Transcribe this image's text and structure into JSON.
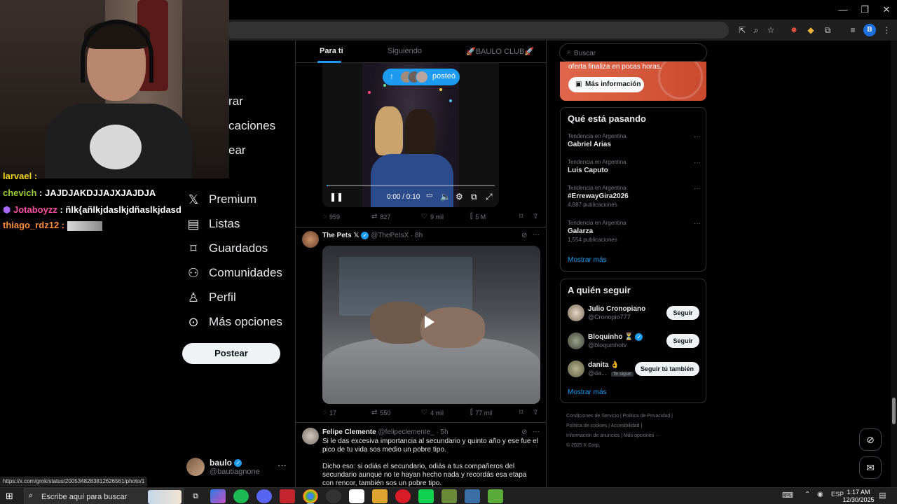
{
  "feed": {
    "tabs": [
      "Para ti",
      "Siguiendo",
      "🚀BAULO CLUB🚀"
    ],
    "posteo_label": "posteó",
    "video_time": "0:00 / 0:10"
  },
  "nav": {
    "partial_items": [
      "rar",
      "caciones",
      "ear"
    ],
    "items": [
      {
        "label": "Premium",
        "icon": "x-logo-icon"
      },
      {
        "label": "Listas",
        "icon": "list-icon"
      },
      {
        "label": "Guardados",
        "icon": "bookmark-icon"
      },
      {
        "label": "Comunidades",
        "icon": "people-icon"
      },
      {
        "label": "Perfil",
        "icon": "person-icon"
      },
      {
        "label": "Más opciones",
        "icon": "more-circle-icon"
      }
    ],
    "post_button": "Postear",
    "account": {
      "name": "baulo",
      "handle": "@bautiagnone",
      "more": "···"
    }
  },
  "tweets": [
    {
      "actions": {
        "replies": "959",
        "reposts": "827",
        "likes": "9 mil",
        "views": "5 M"
      }
    },
    {
      "name": "The Pets 𝕏",
      "handle": "@ThePetsX",
      "time": "· 8h",
      "actions": {
        "replies": "17",
        "reposts": "550",
        "likes": "4 mil",
        "views": "77 mil"
      }
    },
    {
      "name": "Felipe Clemente",
      "handle": "@felipeclemente_",
      "time": "· 5h",
      "text1": "Si le das excesiva importancia al secundario y quinto año y ese fue el pico de tu vida sos medio un pobre tipo.",
      "text2": "Dicho eso: si odiás el secundario, odiás a tus compañeros del secundario aunque no te hayan hecho nada y recordás esa etapa con rencor, también sos un pobre tipo."
    }
  ],
  "right": {
    "search_placeholder": "Buscar",
    "promo": {
      "text": "oferta finaliza en pocas horas.",
      "button": "Más información"
    },
    "trending": {
      "title": "Qué está pasando",
      "items": [
        {
          "context": "Tendencia en Argentina",
          "title": "Gabriel Arias",
          "count": ""
        },
        {
          "context": "Tendencia en Argentina",
          "title": "Luis Caputo",
          "count": ""
        },
        {
          "context": "Tendencia en Argentina",
          "title": "#ErrewayGira2026",
          "count": "4,887 publicaciones"
        },
        {
          "context": "Tendencia en Argentina",
          "title": "Galarza",
          "count": "1,554 publicaciones"
        }
      ],
      "show_more": "Mostrar más"
    },
    "who_to_follow": {
      "title": "A quién seguir",
      "items": [
        {
          "name": "Julio Cronopiano",
          "handle": "@Cronopio777",
          "button": "Seguir"
        },
        {
          "name": "Bloquinho ⏳",
          "handle": "@bloquinhotv",
          "button": "Seguir"
        },
        {
          "name": "danita 👌",
          "handle": "@da...",
          "badge": "Te sigue",
          "button": "Seguir tú también"
        }
      ],
      "show_more": "Mostrar más"
    },
    "footer": {
      "line1": "Condiciones de Servicio  |  Política de Privacidad  |",
      "line2": "Política de cookies  |  Accesibilidad  |",
      "line3": "Información de anuncios  |  Más opciones ···",
      "line4": "© 2025 X Corp."
    }
  },
  "status_url": "https://x.com/grok/status/2005348283812626561/photo/1",
  "chat": [
    {
      "user": "larvael :",
      "msg": "",
      "color": "#f0d21c"
    },
    {
      "user": "chevich",
      "msg": ": JAJDJAKDJJAJXJAJDJA",
      "color": "#9acd32"
    },
    {
      "user": "Jotaboyzz",
      "msg": ": ñlk{añlkjdaslkjdñaslkjdasd",
      "color": "#ff4fa0"
    },
    {
      "user": "thiago_rdz12 :",
      "msg": "",
      "color": "#ff8c3a"
    }
  ],
  "taskbar": {
    "search_placeholder": "Escribe aquí para buscar",
    "lang": "ESP",
    "time": "1:17 AM",
    "date": "12/30/2025"
  }
}
